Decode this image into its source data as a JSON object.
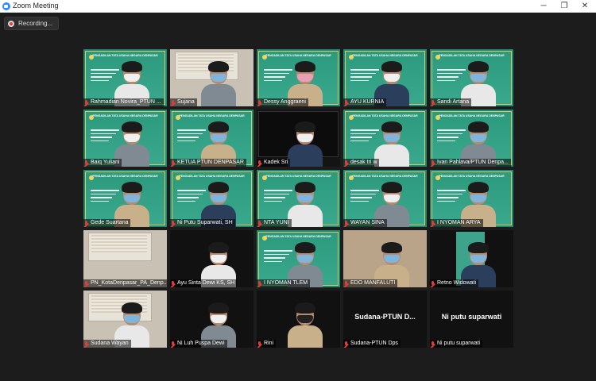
{
  "window": {
    "title": "Zoom Meeting",
    "minimize": "─",
    "maximize": "❐",
    "close": "✕"
  },
  "recording": {
    "label": "Recording..."
  },
  "slide": {
    "header": "PENGADILAN TATA USAHA NEGARA DENPASAR"
  },
  "participants": [
    {
      "name": "Rahmadian Novira_PTUN ...",
      "style": "slide"
    },
    {
      "name": "Sujana",
      "style": "office"
    },
    {
      "name": "Dessy Anggraeni",
      "style": "slide"
    },
    {
      "name": "AYU KURNIA",
      "style": "slide"
    },
    {
      "name": "Sandi Artana",
      "style": "slide"
    },
    {
      "name": "Baiq Yuliani",
      "style": "slide"
    },
    {
      "name": "KETUA PTUN DENPASAR",
      "style": "slide"
    },
    {
      "name": "Kadek Sri",
      "style": "dark"
    },
    {
      "name": "desak tri w",
      "style": "slide"
    },
    {
      "name": "Ivan Pahlava/PTUN Denpa...",
      "style": "slide"
    },
    {
      "name": "Gede Suartana",
      "style": "slide"
    },
    {
      "name": "Ni Putu Suparwati, SH",
      "style": "slide"
    },
    {
      "name": "NTA YUNI",
      "style": "slide"
    },
    {
      "name": "WAYAN SINA",
      "style": "slide"
    },
    {
      "name": "I NYOMAN ARYA",
      "style": "slide"
    },
    {
      "name": "PN_KotaDenpasar_PA_Denp...",
      "style": "office"
    },
    {
      "name": "Ayu Sinta Dewi KS, SH",
      "style": "blank"
    },
    {
      "name": "I NYOMAN TLEM",
      "style": "slide"
    },
    {
      "name": "EDO MANFALUTI",
      "style": "room"
    },
    {
      "name": "Retno Widowati",
      "style": "blank"
    },
    {
      "name": "Sudana Wayan",
      "style": "office"
    },
    {
      "name": "Ni Luh Puspa Dewi",
      "style": "blank"
    },
    {
      "name": "Rini",
      "style": "blank"
    },
    {
      "name": "Sudana-PTUN Dps",
      "style": "blank",
      "big_name": "Sudana-PTUN D..."
    },
    {
      "name": "Ni putu suparwati",
      "style": "blank",
      "big_name": "Ni putu suparwati"
    }
  ]
}
